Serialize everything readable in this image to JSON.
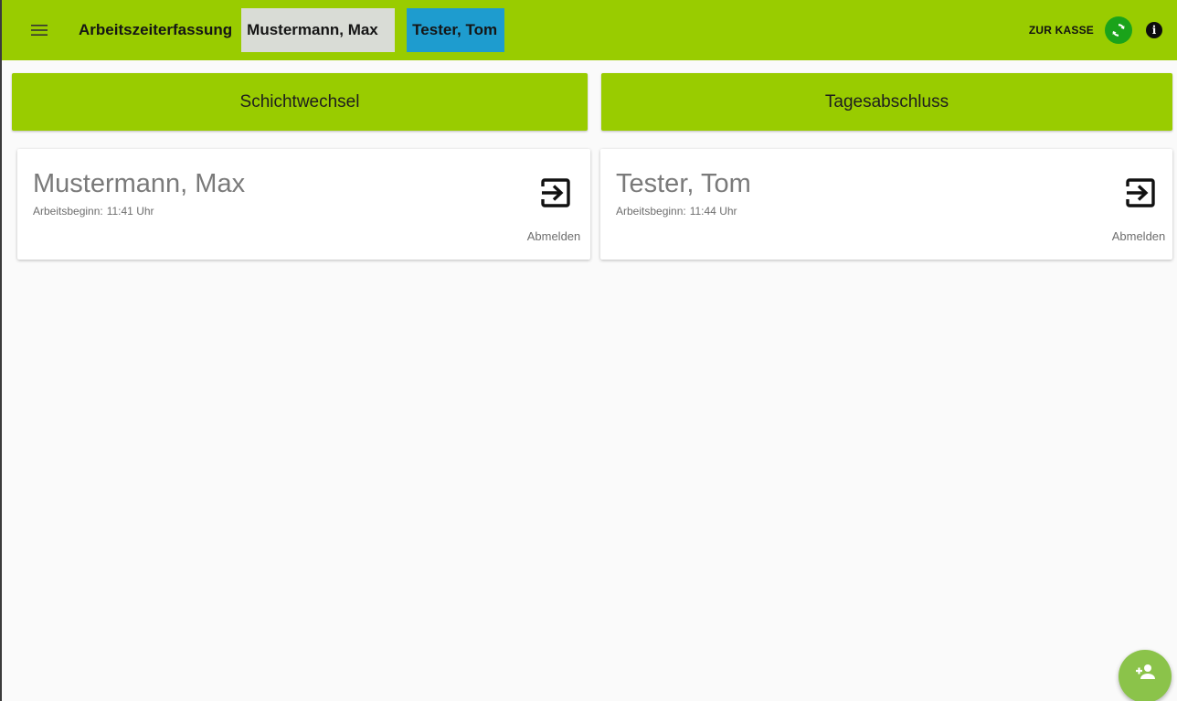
{
  "header": {
    "app_title": "Arbeitszeiterfassung",
    "employee_chips": [
      {
        "label": "Mustermann, Max",
        "color": "#d9dcd6"
      },
      {
        "label": "Tester, Tom",
        "color": "#1e9ccf"
      }
    ],
    "register_link": "ZUR KASSE",
    "icons": {
      "menu": "menu-icon",
      "sync": "sync-icon",
      "info": "info-icon"
    },
    "info_glyph": "i"
  },
  "actions": {
    "shift_change": "Schichtwechsel",
    "day_closing": "Tagesabschluss"
  },
  "employees": [
    {
      "name": "Mustermann, Max",
      "start_label": "Arbeitsbeginn:",
      "start_time": "11:41 Uhr",
      "logout_label": "Abmelden"
    },
    {
      "name": "Tester, Tom",
      "start_label": "Arbeitsbeginn:",
      "start_time": "11:44 Uhr",
      "logout_label": "Abmelden"
    }
  ],
  "fab": {
    "icon": "add-person-icon"
  },
  "colors": {
    "accent": "#99cc00",
    "sync": "#1aa31a",
    "fab": "#8bc34a",
    "background": "#fafafa"
  }
}
